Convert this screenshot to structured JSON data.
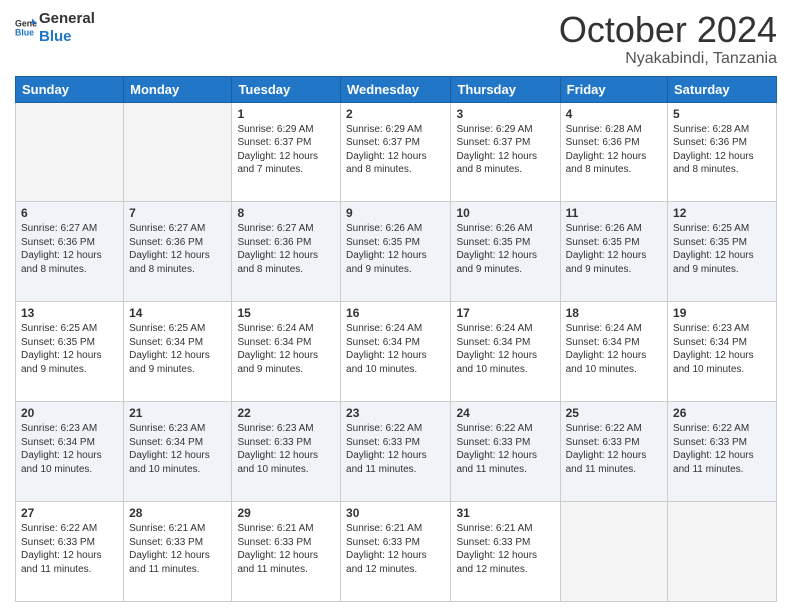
{
  "logo": {
    "line1": "General",
    "line2": "Blue"
  },
  "header": {
    "month": "October 2024",
    "location": "Nyakabindi, Tanzania"
  },
  "weekdays": [
    "Sunday",
    "Monday",
    "Tuesday",
    "Wednesday",
    "Thursday",
    "Friday",
    "Saturday"
  ],
  "weeks": [
    [
      {
        "day": "",
        "info": ""
      },
      {
        "day": "",
        "info": ""
      },
      {
        "day": "1",
        "info": "Sunrise: 6:29 AM\nSunset: 6:37 PM\nDaylight: 12 hours and 7 minutes."
      },
      {
        "day": "2",
        "info": "Sunrise: 6:29 AM\nSunset: 6:37 PM\nDaylight: 12 hours and 8 minutes."
      },
      {
        "day": "3",
        "info": "Sunrise: 6:29 AM\nSunset: 6:37 PM\nDaylight: 12 hours and 8 minutes."
      },
      {
        "day": "4",
        "info": "Sunrise: 6:28 AM\nSunset: 6:36 PM\nDaylight: 12 hours and 8 minutes."
      },
      {
        "day": "5",
        "info": "Sunrise: 6:28 AM\nSunset: 6:36 PM\nDaylight: 12 hours and 8 minutes."
      }
    ],
    [
      {
        "day": "6",
        "info": "Sunrise: 6:27 AM\nSunset: 6:36 PM\nDaylight: 12 hours and 8 minutes."
      },
      {
        "day": "7",
        "info": "Sunrise: 6:27 AM\nSunset: 6:36 PM\nDaylight: 12 hours and 8 minutes."
      },
      {
        "day": "8",
        "info": "Sunrise: 6:27 AM\nSunset: 6:36 PM\nDaylight: 12 hours and 8 minutes."
      },
      {
        "day": "9",
        "info": "Sunrise: 6:26 AM\nSunset: 6:35 PM\nDaylight: 12 hours and 9 minutes."
      },
      {
        "day": "10",
        "info": "Sunrise: 6:26 AM\nSunset: 6:35 PM\nDaylight: 12 hours and 9 minutes."
      },
      {
        "day": "11",
        "info": "Sunrise: 6:26 AM\nSunset: 6:35 PM\nDaylight: 12 hours and 9 minutes."
      },
      {
        "day": "12",
        "info": "Sunrise: 6:25 AM\nSunset: 6:35 PM\nDaylight: 12 hours and 9 minutes."
      }
    ],
    [
      {
        "day": "13",
        "info": "Sunrise: 6:25 AM\nSunset: 6:35 PM\nDaylight: 12 hours and 9 minutes."
      },
      {
        "day": "14",
        "info": "Sunrise: 6:25 AM\nSunset: 6:34 PM\nDaylight: 12 hours and 9 minutes."
      },
      {
        "day": "15",
        "info": "Sunrise: 6:24 AM\nSunset: 6:34 PM\nDaylight: 12 hours and 9 minutes."
      },
      {
        "day": "16",
        "info": "Sunrise: 6:24 AM\nSunset: 6:34 PM\nDaylight: 12 hours and 10 minutes."
      },
      {
        "day": "17",
        "info": "Sunrise: 6:24 AM\nSunset: 6:34 PM\nDaylight: 12 hours and 10 minutes."
      },
      {
        "day": "18",
        "info": "Sunrise: 6:24 AM\nSunset: 6:34 PM\nDaylight: 12 hours and 10 minutes."
      },
      {
        "day": "19",
        "info": "Sunrise: 6:23 AM\nSunset: 6:34 PM\nDaylight: 12 hours and 10 minutes."
      }
    ],
    [
      {
        "day": "20",
        "info": "Sunrise: 6:23 AM\nSunset: 6:34 PM\nDaylight: 12 hours and 10 minutes."
      },
      {
        "day": "21",
        "info": "Sunrise: 6:23 AM\nSunset: 6:34 PM\nDaylight: 12 hours and 10 minutes."
      },
      {
        "day": "22",
        "info": "Sunrise: 6:23 AM\nSunset: 6:33 PM\nDaylight: 12 hours and 10 minutes."
      },
      {
        "day": "23",
        "info": "Sunrise: 6:22 AM\nSunset: 6:33 PM\nDaylight: 12 hours and 11 minutes."
      },
      {
        "day": "24",
        "info": "Sunrise: 6:22 AM\nSunset: 6:33 PM\nDaylight: 12 hours and 11 minutes."
      },
      {
        "day": "25",
        "info": "Sunrise: 6:22 AM\nSunset: 6:33 PM\nDaylight: 12 hours and 11 minutes."
      },
      {
        "day": "26",
        "info": "Sunrise: 6:22 AM\nSunset: 6:33 PM\nDaylight: 12 hours and 11 minutes."
      }
    ],
    [
      {
        "day": "27",
        "info": "Sunrise: 6:22 AM\nSunset: 6:33 PM\nDaylight: 12 hours and 11 minutes."
      },
      {
        "day": "28",
        "info": "Sunrise: 6:21 AM\nSunset: 6:33 PM\nDaylight: 12 hours and 11 minutes."
      },
      {
        "day": "29",
        "info": "Sunrise: 6:21 AM\nSunset: 6:33 PM\nDaylight: 12 hours and 11 minutes."
      },
      {
        "day": "30",
        "info": "Sunrise: 6:21 AM\nSunset: 6:33 PM\nDaylight: 12 hours and 12 minutes."
      },
      {
        "day": "31",
        "info": "Sunrise: 6:21 AM\nSunset: 6:33 PM\nDaylight: 12 hours and 12 minutes."
      },
      {
        "day": "",
        "info": ""
      },
      {
        "day": "",
        "info": ""
      }
    ]
  ]
}
